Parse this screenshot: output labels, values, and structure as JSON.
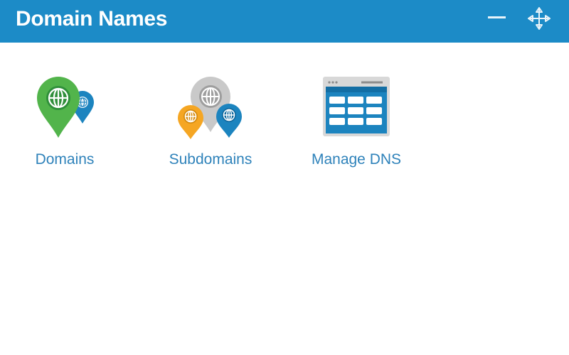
{
  "window": {
    "title": "Domain Names",
    "header_color": "#1c8bc7",
    "controls": {
      "minimize_icon": "minimize-icon",
      "move_icon": "move-icon"
    }
  },
  "tiles": [
    {
      "label": "Domains",
      "icon": "domains-icon"
    },
    {
      "label": "Subdomains",
      "icon": "subdomains-icon"
    },
    {
      "label": "Manage DNS",
      "icon": "manage-dns-icon"
    }
  ],
  "colors": {
    "link_text": "#2e82ba",
    "green": "#52b44b",
    "blue": "#1c84bf",
    "orange": "#f5a623",
    "gray": "#c9c9c9"
  }
}
